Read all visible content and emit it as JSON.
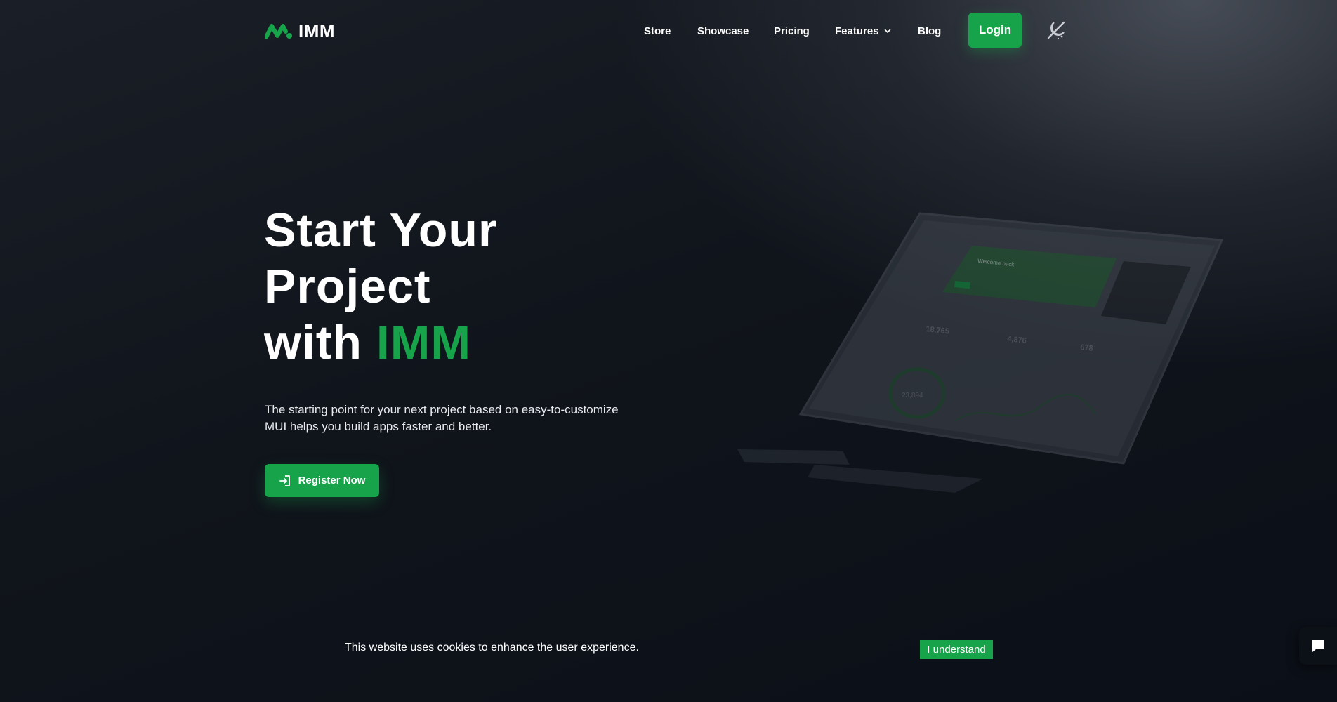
{
  "brand": {
    "name": "IMM",
    "accent_color": "#16a34a"
  },
  "nav": {
    "items": [
      {
        "label": "Store"
      },
      {
        "label": "Showcase"
      },
      {
        "label": "Pricing"
      },
      {
        "label": "Features",
        "icon": "chevron-down-icon"
      },
      {
        "label": "Blog"
      }
    ],
    "login_label": "Login",
    "theme_icon": "theme-toggle-icon"
  },
  "hero": {
    "title_line1": "Start Your",
    "title_line2": "Project",
    "title_line3_prefix": "with",
    "title_line3_accent": "IMM",
    "subtitle": "The starting point for your next project based on easy-to-customize MUI helps you build apps faster and better.",
    "cta_label": "Register Now",
    "cta_icon": "login-arrow-icon"
  },
  "mockup": {
    "welcome": "Welcome back",
    "stats": [
      "18,765",
      "4,876",
      "678"
    ],
    "ring_value": "23,894"
  },
  "cookie": {
    "message": "This website uses cookies to enhance the user experience.",
    "button_label": "I understand"
  },
  "chat": {
    "icon": "chat-icon"
  }
}
